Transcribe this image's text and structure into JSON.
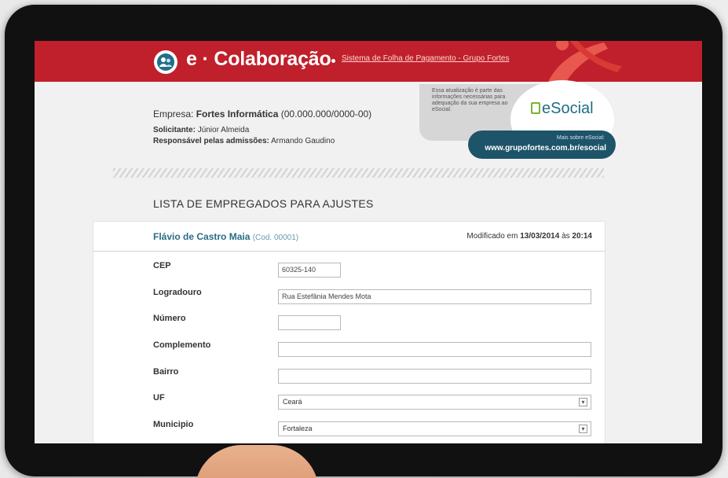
{
  "header": {
    "brand_prefix": "e",
    "brand_name": "Colaboração",
    "link_text": "Sistema de Folha de Pagamento - Grupo Fortes"
  },
  "company": {
    "label": "Empresa:",
    "name": "Fortes Informática",
    "cnpj": "(00.000.000/0000-00)",
    "requester_label": "Solicitante:",
    "requester": "Júnior Almeida",
    "admissions_label": "Responsável pelas admissões:",
    "admissions": "Armando Gaudino"
  },
  "esocial": {
    "note": "Essa atualização é parte das informações necessárias para adequação da sua empresa ao eSocial.",
    "brand": "eSocial",
    "more_label": "Mais sobre eSocial:",
    "url": "www.grupofortes.com.br/esocial"
  },
  "list": {
    "title": "LISTA DE EMPREGADOS PARA AJUSTES",
    "employee": {
      "name": "Flávio de Castro Maia",
      "code": "(Cod. 00001)",
      "modified_prefix": "Modificado em",
      "modified_date": "13/03/2014",
      "modified_mid": "às",
      "modified_time": "20:14"
    },
    "fields": [
      {
        "label": "CEP",
        "value": "60325-140"
      },
      {
        "label": "Logradouro",
        "value": "Rua Estefânia Mendes Mota"
      },
      {
        "label": "Número",
        "value": ""
      },
      {
        "label": "Complemento",
        "value": ""
      },
      {
        "label": "Bairro",
        "value": ""
      },
      {
        "label": "UF",
        "value": "Ceará"
      },
      {
        "label": "Municipio",
        "value": "Fortaleza"
      }
    ]
  },
  "icons": {
    "logo": "people-icon",
    "select_arrow": "dropdown-arrow-icon"
  },
  "colors": {
    "header_red": "#c0202b",
    "link_blue": "#2a6c86",
    "esocial_teal": "#1e5469",
    "esocial_green": "#7ab531"
  }
}
